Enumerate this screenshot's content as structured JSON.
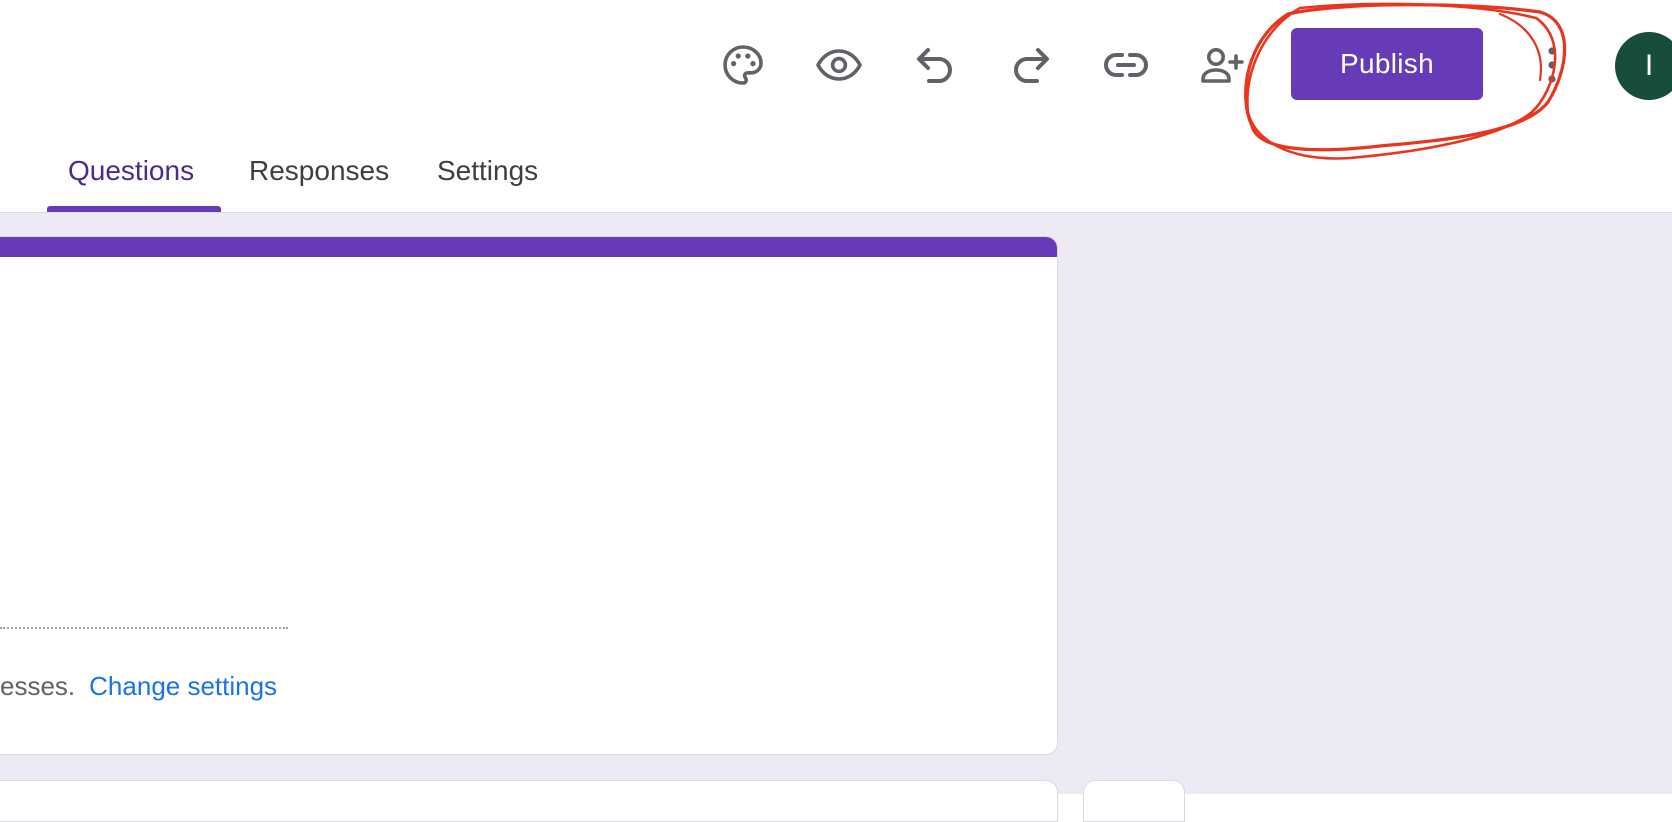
{
  "toolbar": {
    "icons": [
      "palette-icon",
      "eye-icon",
      "undo-icon",
      "redo-icon",
      "link-icon",
      "person-add-icon",
      "more-vert-icon"
    ],
    "publish_label": "Publish",
    "avatar_initial": "I"
  },
  "tabs": [
    {
      "label": "Questions",
      "active": true
    },
    {
      "label": "Responses",
      "active": false
    },
    {
      "label": "Settings",
      "active": false
    }
  ],
  "form": {
    "notice_text": "esses.",
    "notice_link": "Change settings"
  },
  "colors": {
    "accent": "#673ab7",
    "link": "#1a73e8",
    "canvas": "#ede9f5",
    "avatar": "#174d3c",
    "annotation": "#e8361e"
  }
}
